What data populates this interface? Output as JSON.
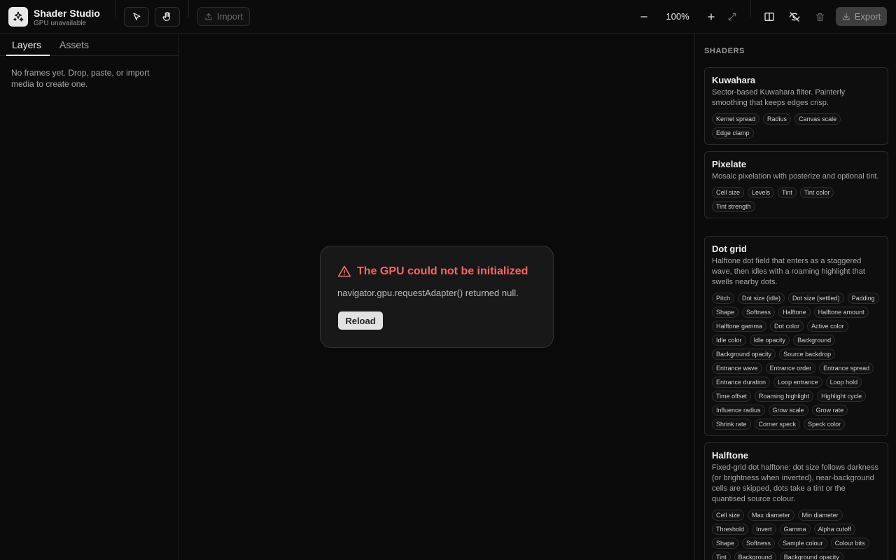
{
  "app": {
    "title": "Shader Studio",
    "subtitle": "GPU unavailable"
  },
  "toolbar": {
    "import_label": "Import",
    "zoom_level": "100%",
    "export_label": "Export"
  },
  "left_panel": {
    "tabs": [
      {
        "label": "Layers"
      },
      {
        "label": "Assets"
      }
    ],
    "empty_message": "No frames yet. Drop, paste, or import media to create one."
  },
  "error": {
    "title": "The GPU could not be initialized",
    "message": "navigator.gpu.requestAdapter() returned null.",
    "reload_label": "Reload"
  },
  "right_panel": {
    "heading": "SHADERS",
    "shaders": [
      {
        "title": "Kuwahara",
        "description": "Sector-based Kuwahara filter. Painterly smoothing that keeps edges crisp.",
        "params": [
          "Kernel spread",
          "Radius",
          "Canvas scale",
          "Edge clamp"
        ]
      },
      {
        "title": "Pixelate",
        "description": "Mosaic pixelation with posterize and optional tint.",
        "params": [
          "Cell size",
          "Levels",
          "Tint",
          "Tint color",
          "Tint strength"
        ]
      },
      {
        "title": "Dot grid",
        "description": "Halftone dot field that enters as a staggered wave, then idles with a roaming highlight that swells nearby dots.",
        "params": [
          "Pitch",
          "Dot size (idle)",
          "Dot size (settled)",
          "Padding",
          "Shape",
          "Softness",
          "Halftone",
          "Halftone amount",
          "Halftone gamma",
          "Dot color",
          "Active color",
          "Idle color",
          "Idle opacity",
          "Background",
          "Background opacity",
          "Source backdrop",
          "Entrance wave",
          "Entrance order",
          "Entrance spread",
          "Entrance duration",
          "Loop entrance",
          "Loop hold",
          "Time offset",
          "Roaming highlight",
          "Highlight cycle",
          "Influence radius",
          "Grow scale",
          "Grow rate",
          "Shrink rate",
          "Corner speck",
          "Speck color"
        ]
      },
      {
        "title": "Halftone",
        "description": "Fixed-grid dot halftone: dot size follows darkness (or brightness when inverted), near-background cells are skipped, dots take a tint or the quantised source colour.",
        "params": [
          "Cell size",
          "Max diameter",
          "Min diameter",
          "Threshold",
          "Invert",
          "Gamma",
          "Alpha cutoff",
          "Shape",
          "Softness",
          "Sample colour",
          "Colour bits",
          "Tint",
          "Background",
          "Background opacity"
        ]
      }
    ]
  },
  "colors": {
    "error": "#f06a6a",
    "accent_light": "#e2e2e2",
    "background": "#0b0b0b"
  }
}
